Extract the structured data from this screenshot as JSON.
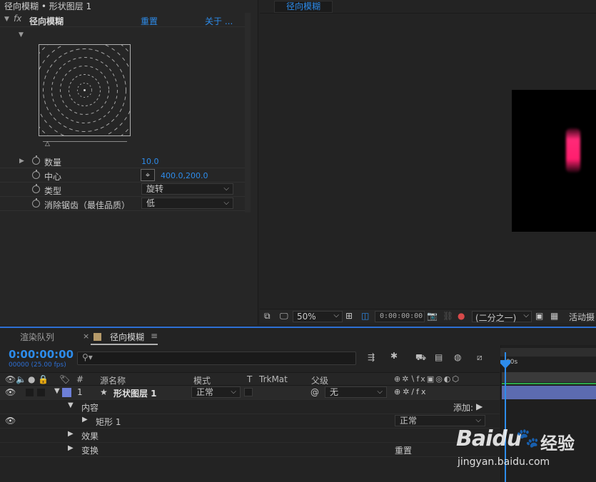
{
  "effect_controls": {
    "title": "径向模糊 • 形状图层 1",
    "effect_name": "径向模糊",
    "reset_label": "重置",
    "about_label": "关于 ...",
    "fx_label": "fx",
    "properties": [
      {
        "label": "数量",
        "value": "10.0"
      },
      {
        "label": "中心",
        "value": "400.0,200.0"
      },
      {
        "label": "类型",
        "value": "旋转"
      },
      {
        "label": "消除锯齿（最佳品质）",
        "value": "低"
      }
    ]
  },
  "viewer": {
    "tab_label": "径向模糊",
    "zoom": "50%",
    "timecode": "0:00:00:00",
    "resolution": "(二分之一)",
    "camera_label": "活动摄"
  },
  "timeline": {
    "tabs": [
      {
        "label": "渲染队列"
      },
      {
        "label": "径向模糊"
      }
    ],
    "time": "0:00:00:00",
    "time_sub": "00000 (25.00 fps)",
    "search_placeholder": "",
    "columns": {
      "number": "#",
      "source_name": "源名称",
      "mode": "模式",
      "t": "T",
      "trkmat": "TrkMat",
      "parent": "父级"
    },
    "ruler_label": "00s",
    "layer": {
      "number": "1",
      "name": "形状图层 1",
      "mode": "正常",
      "parent": "无",
      "color": "#6d7fd8"
    },
    "children": [
      {
        "label": "内容",
        "extra": "添加:"
      },
      {
        "label": "矩形 1",
        "mode": "正常"
      },
      {
        "label": "效果"
      },
      {
        "label": "变换",
        "extra": "重置"
      }
    ]
  },
  "watermark": {
    "brand": "Baidu",
    "brand_cn": "经验",
    "url": "jingyan.baidu.com"
  },
  "colors": {
    "accent": "#2d8ceb",
    "layer_bar": "#5c6bb0",
    "pink": "#ff1e6e"
  }
}
